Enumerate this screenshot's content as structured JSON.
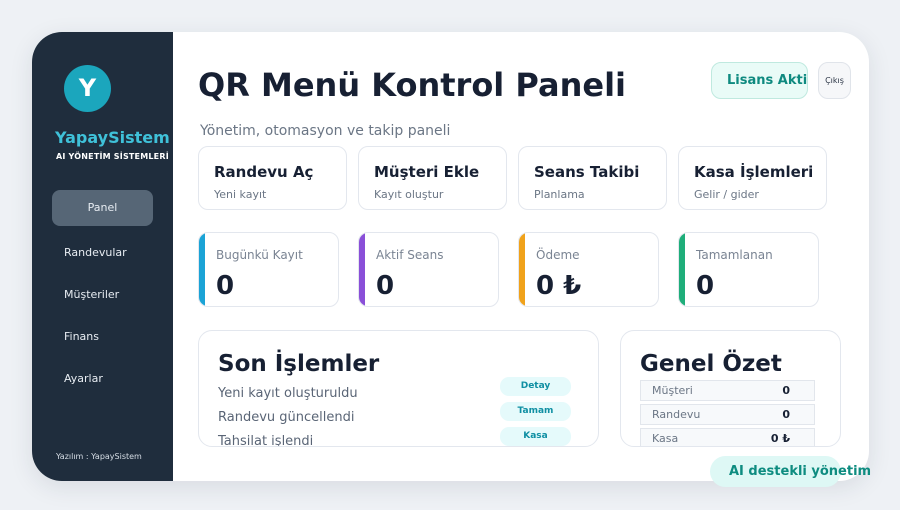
{
  "sidebar": {
    "logo_letter": "Y",
    "brand": "YapaySistem",
    "brand_sub": "AI YÖNETİM SİSTEMLERİ",
    "items": [
      {
        "label": "Panel",
        "active": true
      },
      {
        "label": "Randevular",
        "active": false
      },
      {
        "label": "Müşteriler",
        "active": false
      },
      {
        "label": "Finans",
        "active": false
      },
      {
        "label": "Ayarlar",
        "active": false
      }
    ],
    "footer": "Yazılım : YapaySistem"
  },
  "header": {
    "title": "QR Menü Kontrol Paneli",
    "subtitle": "Yönetim, otomasyon ve takip paneli",
    "license_badge": "Lisans Aktif",
    "logout_label": "Çıkış"
  },
  "quick_actions": [
    {
      "title": "Randevu Aç",
      "subtitle": "Yeni kayıt"
    },
    {
      "title": "Müşteri Ekle",
      "subtitle": "Kayıt oluştur"
    },
    {
      "title": "Seans Takibi",
      "subtitle": "Planlama"
    },
    {
      "title": "Kasa İşlemleri",
      "subtitle": "Gelir / gider"
    }
  ],
  "stats": [
    {
      "label": "Bugünkü Kayıt",
      "value": "0",
      "color": "#1ba3d6"
    },
    {
      "label": "Aktif Seans",
      "value": "0",
      "color": "#8a4fd8"
    },
    {
      "label": "Ödeme",
      "value": "0 ₺",
      "color": "#f0a21b"
    },
    {
      "label": "Tamamlanan",
      "value": "0",
      "color": "#1fae7a"
    }
  ],
  "recent": {
    "title": "Son İşlemler",
    "items": [
      {
        "text": "Yeni kayıt oluşturuldu",
        "tag": "Detay"
      },
      {
        "text": "Randevu güncellendi",
        "tag": "Tamam"
      },
      {
        "text": "Tahsilat işlendi",
        "tag": "Kasa"
      }
    ]
  },
  "summary": {
    "title": "Genel Özet",
    "rows": [
      {
        "label": "Müşteri",
        "value": "0"
      },
      {
        "label": "Randevu",
        "value": "0"
      },
      {
        "label": "Kasa",
        "value": "0 ₺"
      }
    ]
  },
  "ai_badge": "AI destekli yönetim"
}
